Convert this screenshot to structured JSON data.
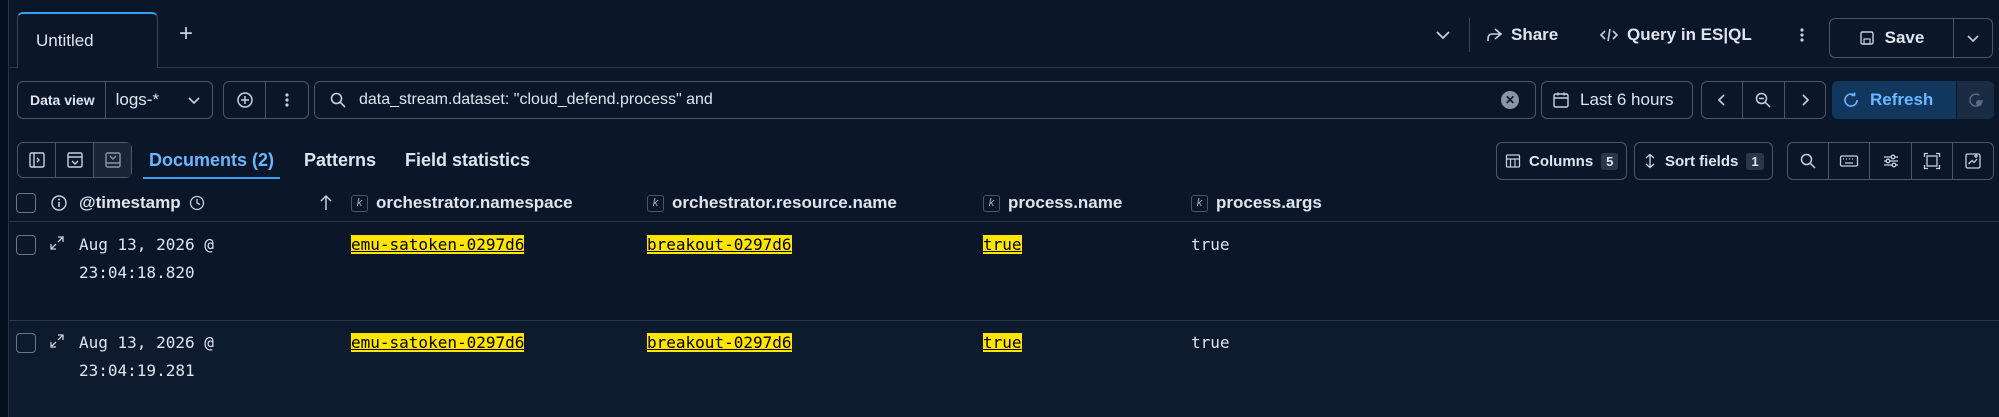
{
  "tabs": {
    "active": "Untitled"
  },
  "toolbar": {
    "share": "Share",
    "query_esql": "Query in ES|QL",
    "save": "Save"
  },
  "query_bar": {
    "data_view_label": "Data view",
    "data_view_value": "logs-*",
    "query_text": "data_stream.dataset: \"cloud_defend.process\" and",
    "time_range": "Last 6 hours",
    "refresh": "Refresh"
  },
  "view_tabs": {
    "documents": "Documents (2)",
    "patterns": "Patterns",
    "field_statistics": "Field statistics"
  },
  "controls": {
    "columns_label": "Columns",
    "columns_count": "5",
    "sort_label": "Sort fields",
    "sort_count": "1"
  },
  "columns": [
    "@timestamp",
    "orchestrator.namespace",
    "orchestrator.resource.name",
    "process.name",
    "process.args"
  ],
  "rows": [
    {
      "timestamp_1": "Aug 13, 2026 @",
      "timestamp_2": "23:04:18.820",
      "namespace": "emu-satoken-0297d6",
      "resource": "breakout-0297d6",
      "pname": "true",
      "pargs": "true"
    },
    {
      "timestamp_1": "Aug 13, 2026 @",
      "timestamp_2": "23:04:19.281",
      "namespace": "emu-satoken-0297d6",
      "resource": "breakout-0297d6",
      "pname": "true",
      "pargs": "true"
    }
  ],
  "colors": {
    "accent": "#36a2ef",
    "highlight": "#ffe500",
    "background": "#0b1628"
  }
}
